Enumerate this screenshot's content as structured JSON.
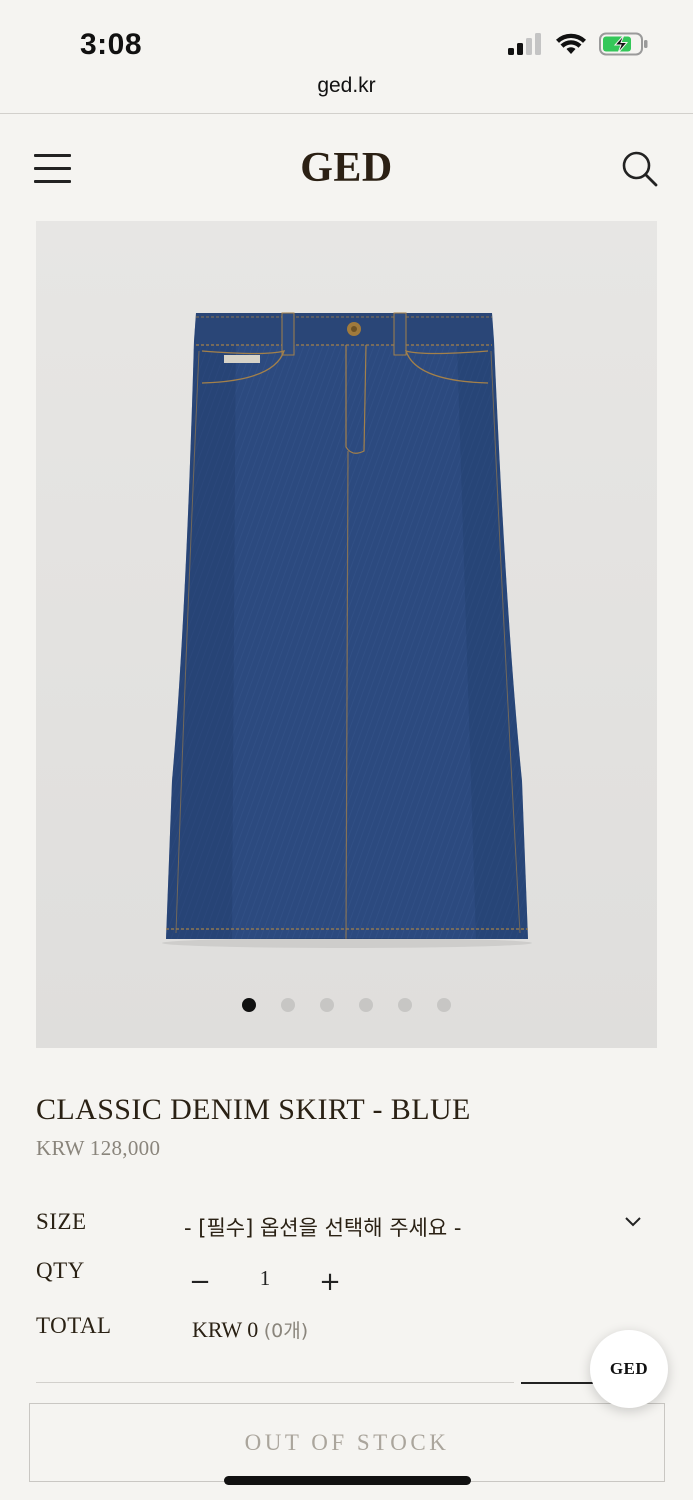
{
  "status_bar": {
    "time": "3:08"
  },
  "browser": {
    "url": "ged.kr"
  },
  "header": {
    "logo": "GED"
  },
  "gallery": {
    "image_count": 6,
    "active_index": 0
  },
  "product": {
    "title": "CLASSIC DENIM SKIRT - BLUE",
    "price": "KRW 128,000"
  },
  "options": {
    "size_label": "SIZE",
    "size_select": "- [필수] 옵션을 선택해 주세요 -",
    "qty_label": "QTY",
    "qty_minus": "−",
    "qty_value": "1",
    "qty_plus": "+",
    "total_label": "TOTAL",
    "total_value": "KRW 0",
    "total_count": "(0개)"
  },
  "actions": {
    "out_of_stock": "OUT OF STOCK"
  },
  "chat": {
    "label": "GED"
  },
  "colors": {
    "background": "#f5f4f1",
    "logo": "#2b2014",
    "denim": "#2c4a7f"
  }
}
